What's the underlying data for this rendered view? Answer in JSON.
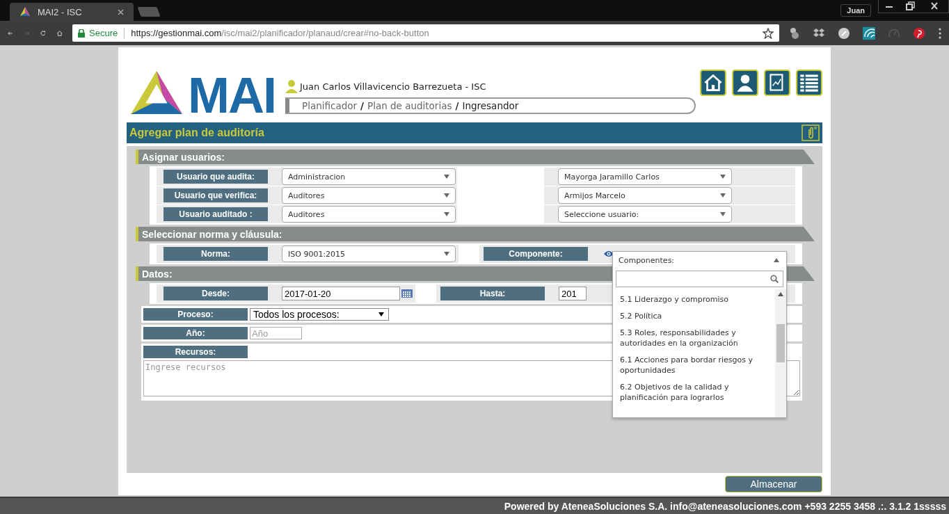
{
  "browser": {
    "tab_title": "MAI2 - ISC",
    "profile": "Juan",
    "secure_label": "Secure",
    "url_host": "https://gestionmai.com",
    "url_path": "/isc/mai2/planificador/planaud/crear#no-back-button"
  },
  "header": {
    "logo_text": "MAI",
    "user": "Juan Carlos Villavicencio Barrezueta - ISC",
    "breadcrumb": [
      "Planificador",
      "Plan de auditorias",
      "Ingresandor"
    ],
    "separator": "/"
  },
  "title": "Agregar plan de auditoría",
  "assign": {
    "heading": "Asignar usuarios:",
    "rows": [
      {
        "label": "Usuario que audita:",
        "group": "Administracion",
        "user": "Mayorga Jaramillo Carlos"
      },
      {
        "label": "Usuario que verifica:",
        "group": "Auditores",
        "user": "Armijos Marcelo"
      },
      {
        "label": "Usuario auditado :",
        "group": "Auditores",
        "user": "Seleccione usuario:"
      }
    ]
  },
  "norma": {
    "heading": "Seleccionar norma y cláusula:",
    "label": "Norma:",
    "value": "ISO 9001:2015",
    "component_label": "Componente:"
  },
  "datos": {
    "heading": "Datos:",
    "desde_label": "Desde:",
    "desde": "2017-01-20",
    "hasta_label": "Hasta:",
    "hasta": "201",
    "proceso_label": "Proceso:",
    "proceso": "Todos los procesos:",
    "anio_label": "Año:",
    "anio_placeholder": "Año",
    "recursos_label": "Recursos:",
    "recursos_placeholder": "Ingrese recursos"
  },
  "dropdown": {
    "header": "Componentes:",
    "items": [
      {
        "text": "5.1 Liderazgo y compromiso"
      },
      {
        "text": "5.2 Política"
      },
      {
        "text": "5.3 Roles, responsabilidades y autoridades en la organización"
      },
      {
        "text": "6.1 Acciones para bordar riesgos y oportunidades"
      },
      {
        "text": "6.2 Objetivos de la calidad y planificación para lograrlos"
      }
    ]
  },
  "save_button": "Almacenar",
  "footer": "Powered by AteneaSoluciones S.A. info@ateneasoluciones.com +593 2255 3458 .:. 3.1.2 1sssss"
}
